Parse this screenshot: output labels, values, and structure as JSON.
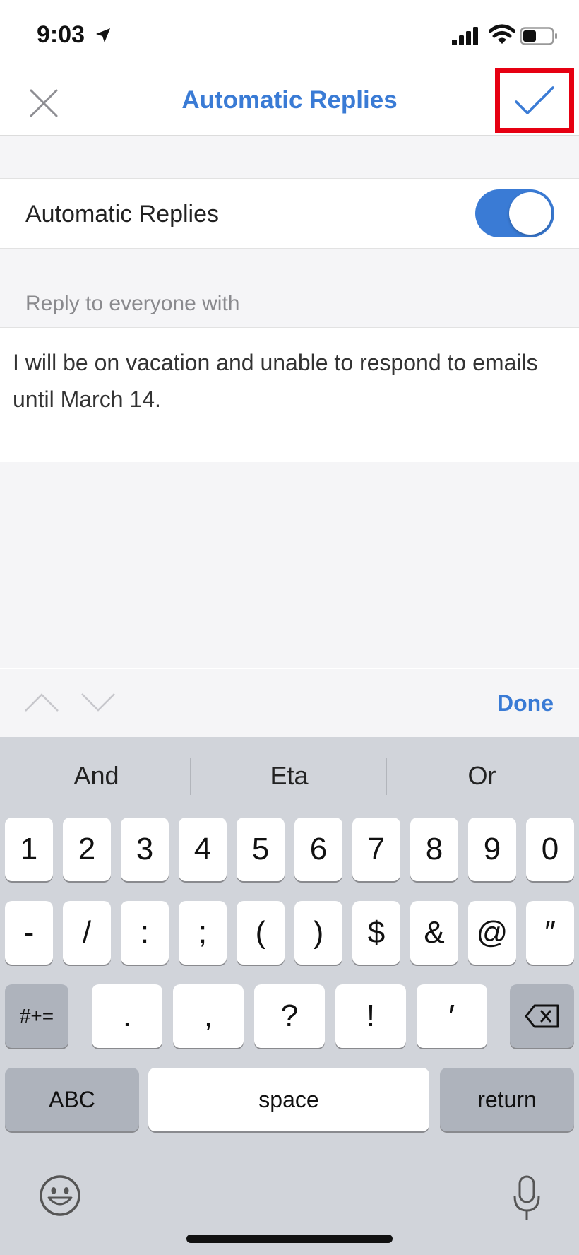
{
  "status_bar": {
    "time": "9:03"
  },
  "nav": {
    "title": "Automatic Replies"
  },
  "toggle_row": {
    "label": "Automatic Replies",
    "enabled": true
  },
  "section": {
    "header": "Reply to everyone with"
  },
  "reply": {
    "text": "I will be on vacation and unable to respond to emails until March 14."
  },
  "accessory": {
    "done_label": "Done"
  },
  "keyboard": {
    "suggestions": [
      "And",
      "Eta",
      "Or"
    ],
    "row1": [
      "1",
      "2",
      "3",
      "4",
      "5",
      "6",
      "7",
      "8",
      "9",
      "0"
    ],
    "row2": [
      "-",
      "/",
      ":",
      ";",
      "(",
      ")",
      "$",
      "&",
      "@",
      "″"
    ],
    "row3": {
      "shift": "#+=",
      "keys": [
        ".",
        ",",
        "?",
        "!",
        "′"
      ]
    },
    "row4": {
      "abc": "ABC",
      "space": "space",
      "return": "return"
    }
  },
  "colors": {
    "accent": "#3a7bd5",
    "highlight_box": "#e60012"
  }
}
